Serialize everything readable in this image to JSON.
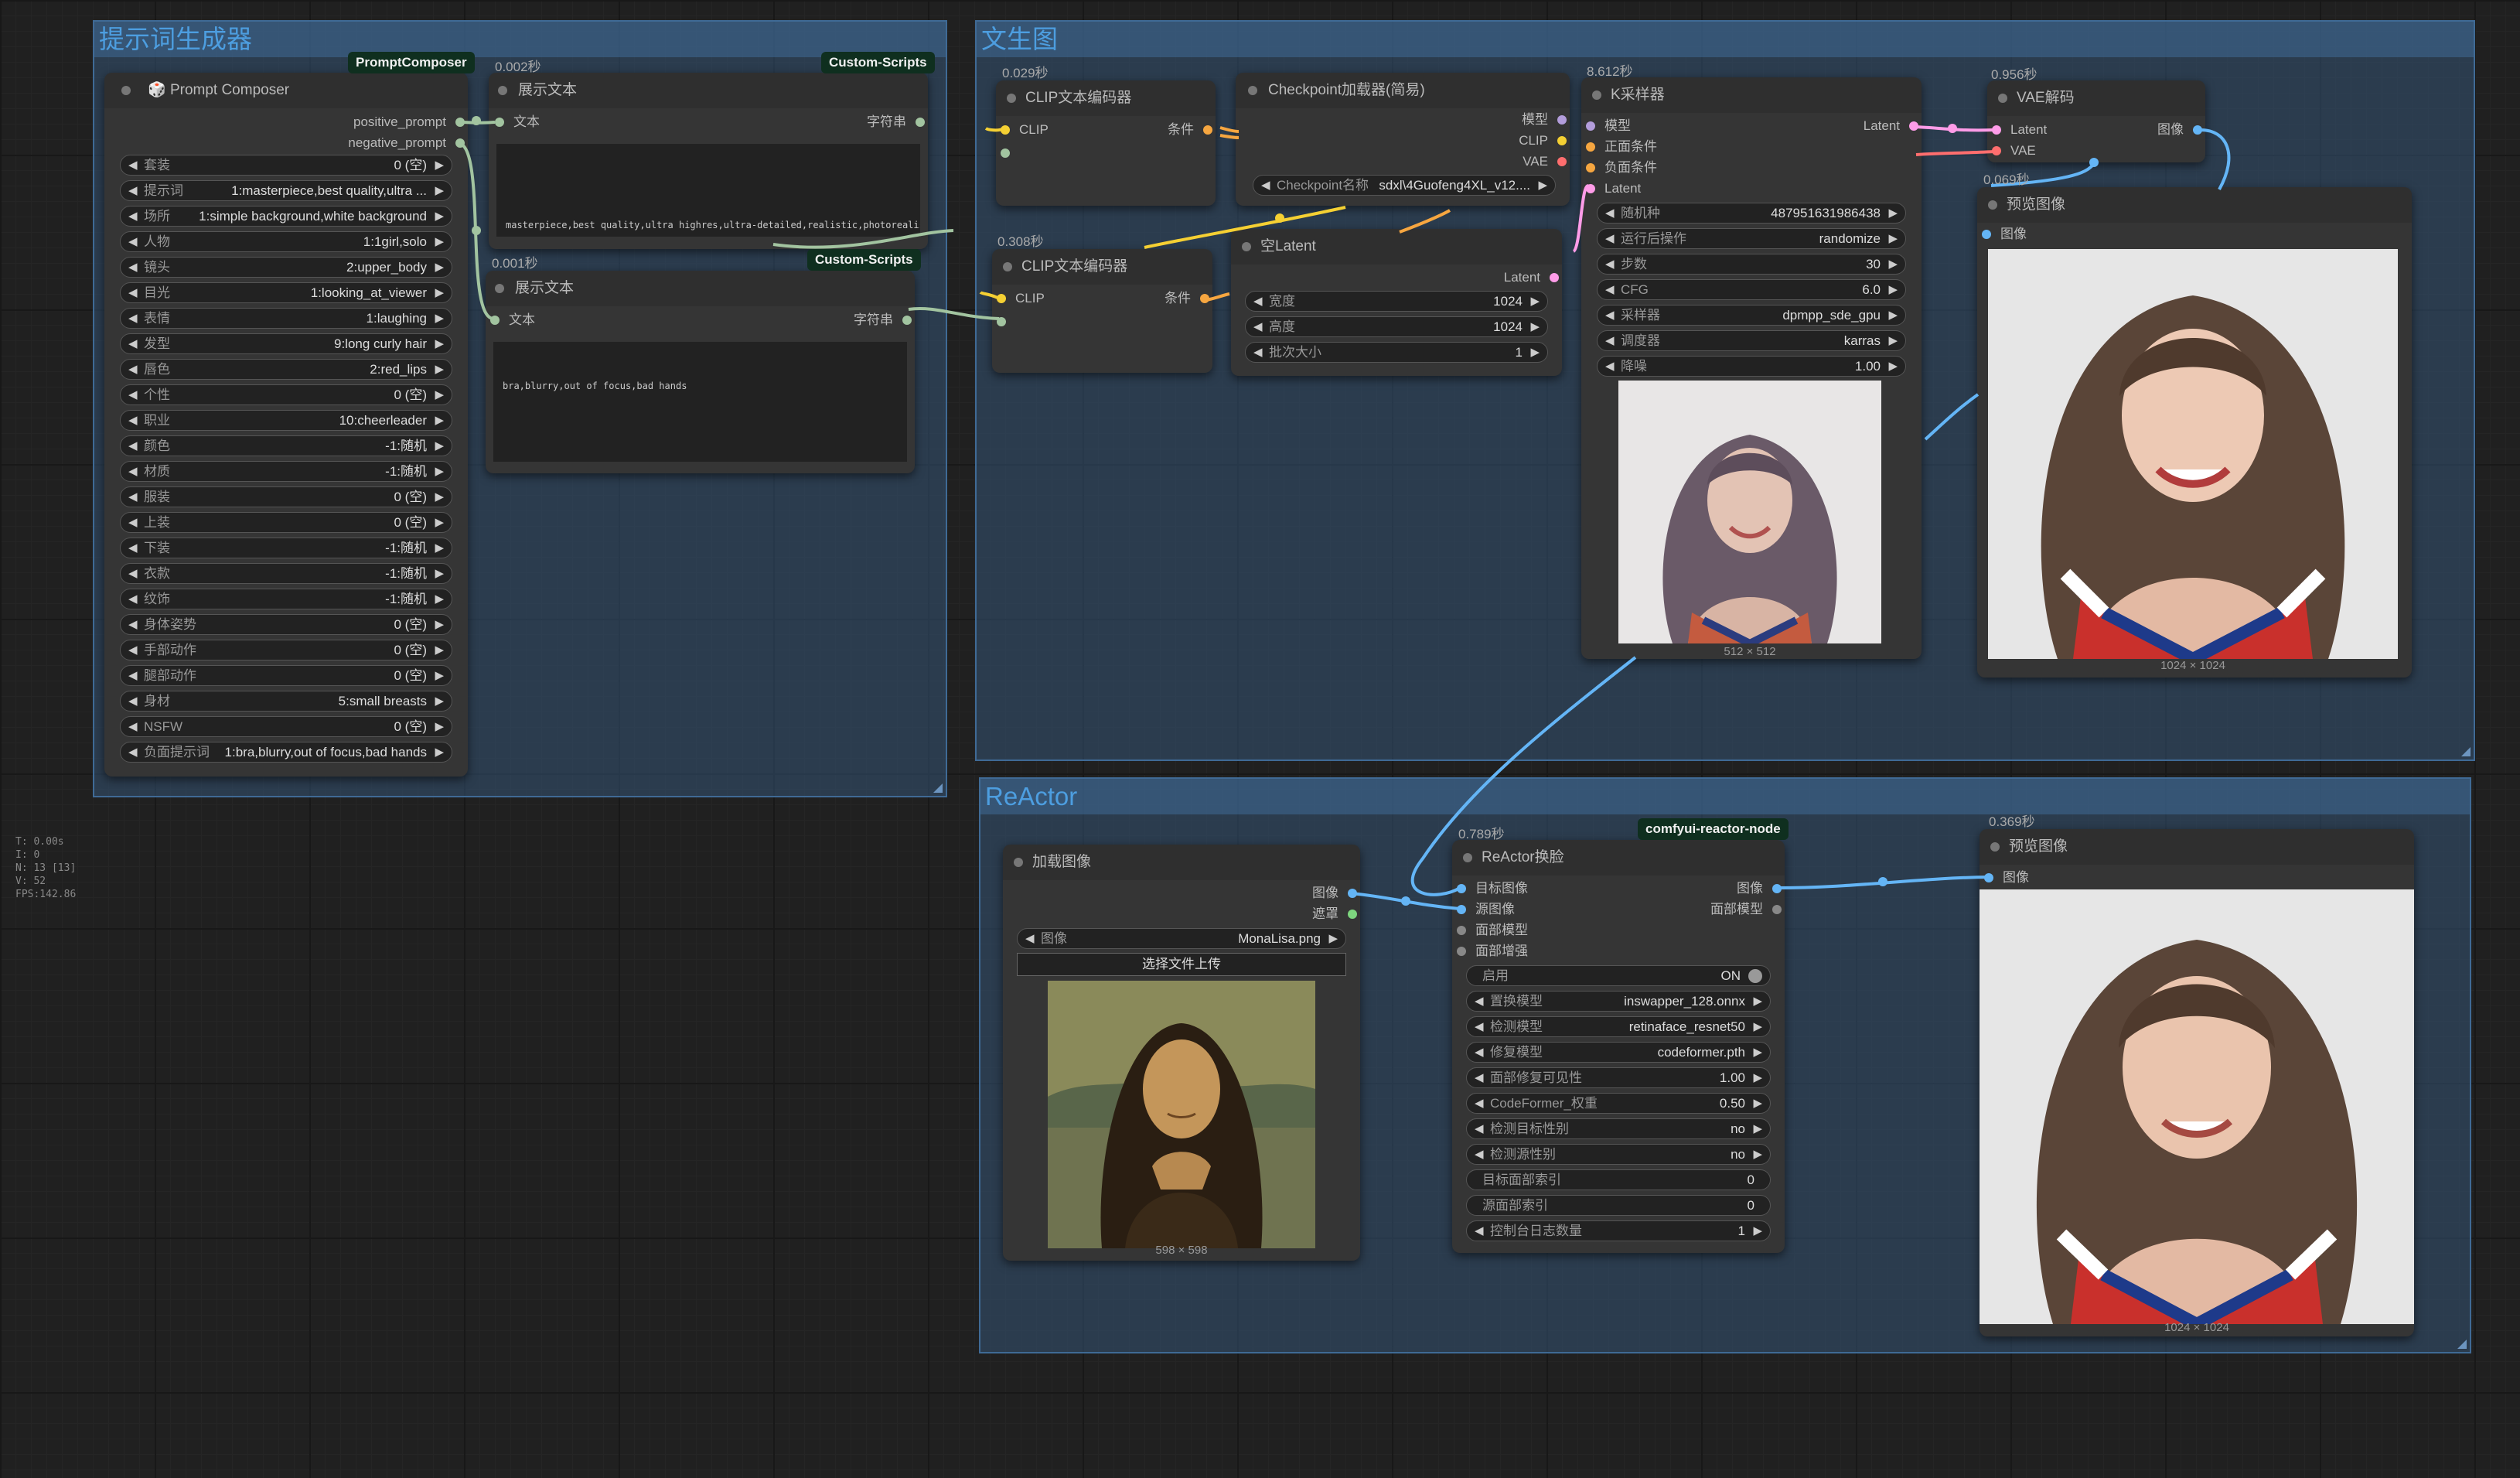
{
  "groups": {
    "prompt": {
      "title": "提示词生成器"
    },
    "t2i": {
      "title": "文生图"
    },
    "reactor": {
      "title": "ReActor"
    }
  },
  "nodes": {
    "prompt_composer": {
      "title": "Prompt Composer",
      "badge": "PromptComposer",
      "outputs": [
        "positive_prompt",
        "negative_prompt"
      ],
      "widgets": [
        {
          "label": "套装",
          "value": "0 (空)"
        },
        {
          "label": "提示词",
          "value": "1:masterpiece,best quality,ultra ..."
        },
        {
          "label": "场所",
          "value": "1:simple background,white background"
        },
        {
          "label": "人物",
          "value": "1:1girl,solo"
        },
        {
          "label": "镜头",
          "value": "2:upper_body"
        },
        {
          "label": "目光",
          "value": "1:looking_at_viewer"
        },
        {
          "label": "表情",
          "value": "1:laughing"
        },
        {
          "label": "发型",
          "value": "9:long curly hair"
        },
        {
          "label": "唇色",
          "value": "2:red_lips"
        },
        {
          "label": "个性",
          "value": "0 (空)"
        },
        {
          "label": "职业",
          "value": "10:cheerleader"
        },
        {
          "label": "颜色",
          "value": "-1:随机"
        },
        {
          "label": "材质",
          "value": "-1:随机"
        },
        {
          "label": "服装",
          "value": "0 (空)"
        },
        {
          "label": "上装",
          "value": "0 (空)"
        },
        {
          "label": "下装",
          "value": "-1:随机"
        },
        {
          "label": "衣款",
          "value": "-1:随机"
        },
        {
          "label": "纹饰",
          "value": "-1:随机"
        },
        {
          "label": "身体姿势",
          "value": "0 (空)"
        },
        {
          "label": "手部动作",
          "value": "0 (空)"
        },
        {
          "label": "腿部动作",
          "value": "0 (空)"
        },
        {
          "label": "身材",
          "value": "5:small breasts"
        },
        {
          "label": "NSFW",
          "value": "0 (空)"
        },
        {
          "label": "负面提示词",
          "value": "1:bra,blurry,out of focus,bad hands"
        }
      ]
    },
    "show_text_1": {
      "title": "展示文本",
      "timing": "0.002秒",
      "badge": "Custom-Scripts",
      "input": "文本",
      "output": "字符串",
      "text": "masterpiece,best quality,ultra highres,ultra-detailed,realistic,photorealistic,simple background,white background,1girl,solo,upper_body,looking_at_viewer,laughing,long curly hair,red_lips,cheerleader"
    },
    "show_text_2": {
      "title": "展示文本",
      "timing": "0.001秒",
      "badge": "Custom-Scripts",
      "input": "文本",
      "output": "字符串",
      "text": "bra,blurry,out of focus,bad hands"
    },
    "clip_enc_1": {
      "title": "CLIP文本编码器",
      "timing": "0.029秒",
      "input": "CLIP",
      "output": "条件"
    },
    "clip_enc_2": {
      "title": "CLIP文本编码器",
      "timing": "0.308秒",
      "input": "CLIP",
      "output": "条件"
    },
    "checkpoint": {
      "title": "Checkpoint加载器(简易)",
      "outputs": [
        "模型",
        "CLIP",
        "VAE"
      ],
      "widget": {
        "label": "Checkpoint名称",
        "value": "sdxl\\4Guofeng4XL_v12...."
      }
    },
    "empty_latent": {
      "title": "空Latent",
      "output": "Latent",
      "widgets": [
        {
          "label": "宽度",
          "value": "1024"
        },
        {
          "label": "高度",
          "value": "1024"
        },
        {
          "label": "批次大小",
          "value": "1"
        }
      ]
    },
    "ksampler": {
      "title": "K采样器",
      "timing": "8.612秒",
      "inputs": [
        "模型",
        "正面条件",
        "负面条件",
        "Latent"
      ],
      "output": "Latent",
      "widgets": [
        {
          "label": "随机种",
          "value": "487951631986438"
        },
        {
          "label": "运行后操作",
          "value": "randomize"
        },
        {
          "label": "步数",
          "value": "30"
        },
        {
          "label": "CFG",
          "value": "6.0"
        },
        {
          "label": "采样器",
          "value": "dpmpp_sde_gpu"
        },
        {
          "label": "调度器",
          "value": "karras"
        },
        {
          "label": "降噪",
          "value": "1.00"
        }
      ],
      "preview_size": "512 × 512"
    },
    "vae_decode": {
      "title": "VAE解码",
      "timing": "0.956秒",
      "inputs": [
        "Latent",
        "VAE"
      ],
      "output": "图像"
    },
    "preview_1": {
      "title": "预览图像",
      "timing": "0.069秒",
      "input": "图像",
      "size": "1024 × 1024"
    },
    "load_image": {
      "title": "加载图像",
      "outputs": [
        "图像",
        "遮罩"
      ],
      "widget": {
        "label": "图像",
        "value": "MonaLisa.png"
      },
      "upload_label": "选择文件上传",
      "size": "598 × 598"
    },
    "reactor": {
      "title": "ReActor换脸",
      "timing": "0.789秒",
      "badge": "comfyui-reactor-node",
      "inputs": [
        "目标图像",
        "源图像",
        "面部模型",
        "面部增强"
      ],
      "outputs": [
        "图像",
        "面部模型"
      ],
      "toggle": {
        "label": "启用",
        "value": "ON"
      },
      "widgets": [
        {
          "label": "置换模型",
          "value": "inswapper_128.onnx",
          "arrows": true
        },
        {
          "label": "检测模型",
          "value": "retinaface_resnet50",
          "arrows": true
        },
        {
          "label": "修复模型",
          "value": "codeformer.pth",
          "arrows": true
        },
        {
          "label": "面部修复可见性",
          "value": "1.00",
          "arrows": true
        },
        {
          "label": "CodeFormer_权重",
          "value": "0.50",
          "arrows": true
        },
        {
          "label": "检测目标性别",
          "value": "no",
          "arrows": true
        },
        {
          "label": "检测源性别",
          "value": "no",
          "arrows": true
        },
        {
          "label": "目标面部索引",
          "value": "0",
          "arrows": false
        },
        {
          "label": "源面部索引",
          "value": "0",
          "arrows": false
        },
        {
          "label": "控制台日志数量",
          "value": "1",
          "arrows": true
        }
      ]
    },
    "preview_2": {
      "title": "预览图像",
      "timing": "0.369秒",
      "input": "图像",
      "size": "1024 × 1024"
    }
  },
  "stats": [
    "T: 0.00s",
    "I: 0",
    "N: 13 [13]",
    "V: 52",
    "FPS:142.86"
  ],
  "colors": {
    "canvas": "#202020",
    "node": "#353535",
    "group": "#345374",
    "group_title": "#4d9ee0",
    "wire_clip": "#f5d033",
    "wire_cond": "#f6a640",
    "wire_latent": "#ff9ce8",
    "wire_vae": "#ff6e6e",
    "wire_image": "#64b5f6",
    "wire_model": "#b39ddb",
    "wire_string": "#a2c4a0"
  }
}
